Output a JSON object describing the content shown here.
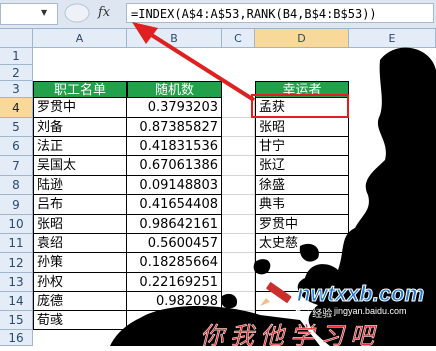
{
  "formula_bar": {
    "fx_label": "fx",
    "formula": "=INDEX(A$4:A$53,RANK(B4,B$4:B$53))"
  },
  "columns": [
    "A",
    "B",
    "C",
    "D",
    "E"
  ],
  "rows": [
    "1",
    "2",
    "3",
    "4",
    "5",
    "6",
    "7",
    "8",
    "9",
    "10",
    "11",
    "12",
    "13",
    "14",
    "15",
    "16"
  ],
  "active_cell": "D4",
  "headers": {
    "A3": "职工名单",
    "B3": "随机数",
    "D3": "幸运者"
  },
  "table": [
    {
      "row": "4",
      "name": "罗贯中",
      "rand": "0.3793203",
      "lucky": "孟获"
    },
    {
      "row": "5",
      "name": "刘备",
      "rand": "0.87385827",
      "lucky": "张昭"
    },
    {
      "row": "6",
      "name": "法正",
      "rand": "0.41831536",
      "lucky": "甘宁"
    },
    {
      "row": "7",
      "name": "吴国太",
      "rand": "0.67061386",
      "lucky": "张辽"
    },
    {
      "row": "8",
      "name": "陆逊",
      "rand": "0.09148803",
      "lucky": "徐盛"
    },
    {
      "row": "9",
      "name": "吕布",
      "rand": "0.41654408",
      "lucky": "典韦"
    },
    {
      "row": "10",
      "name": "张昭",
      "rand": "0.98642161",
      "lucky": "罗贯中"
    },
    {
      "row": "11",
      "name": "袁绍",
      "rand": "0.5600457",
      "lucky": "太史慈"
    },
    {
      "row": "12",
      "name": "孙策",
      "rand": "0.18285664",
      "lucky": ""
    },
    {
      "row": "13",
      "name": "孙权",
      "rand": "0.22169251",
      "lucky": ""
    },
    {
      "row": "14",
      "name": "庞德",
      "rand": "0.982098",
      "lucky": ""
    },
    {
      "row": "15",
      "name": "荀彧",
      "rand": "0.883",
      "lucky": ""
    }
  ],
  "watermark": {
    "site": "nwtxxb.com",
    "sub": "jingyan.baidu.com",
    "tagline": "你我他学习吧",
    "baidu": "Bai 经验"
  }
}
